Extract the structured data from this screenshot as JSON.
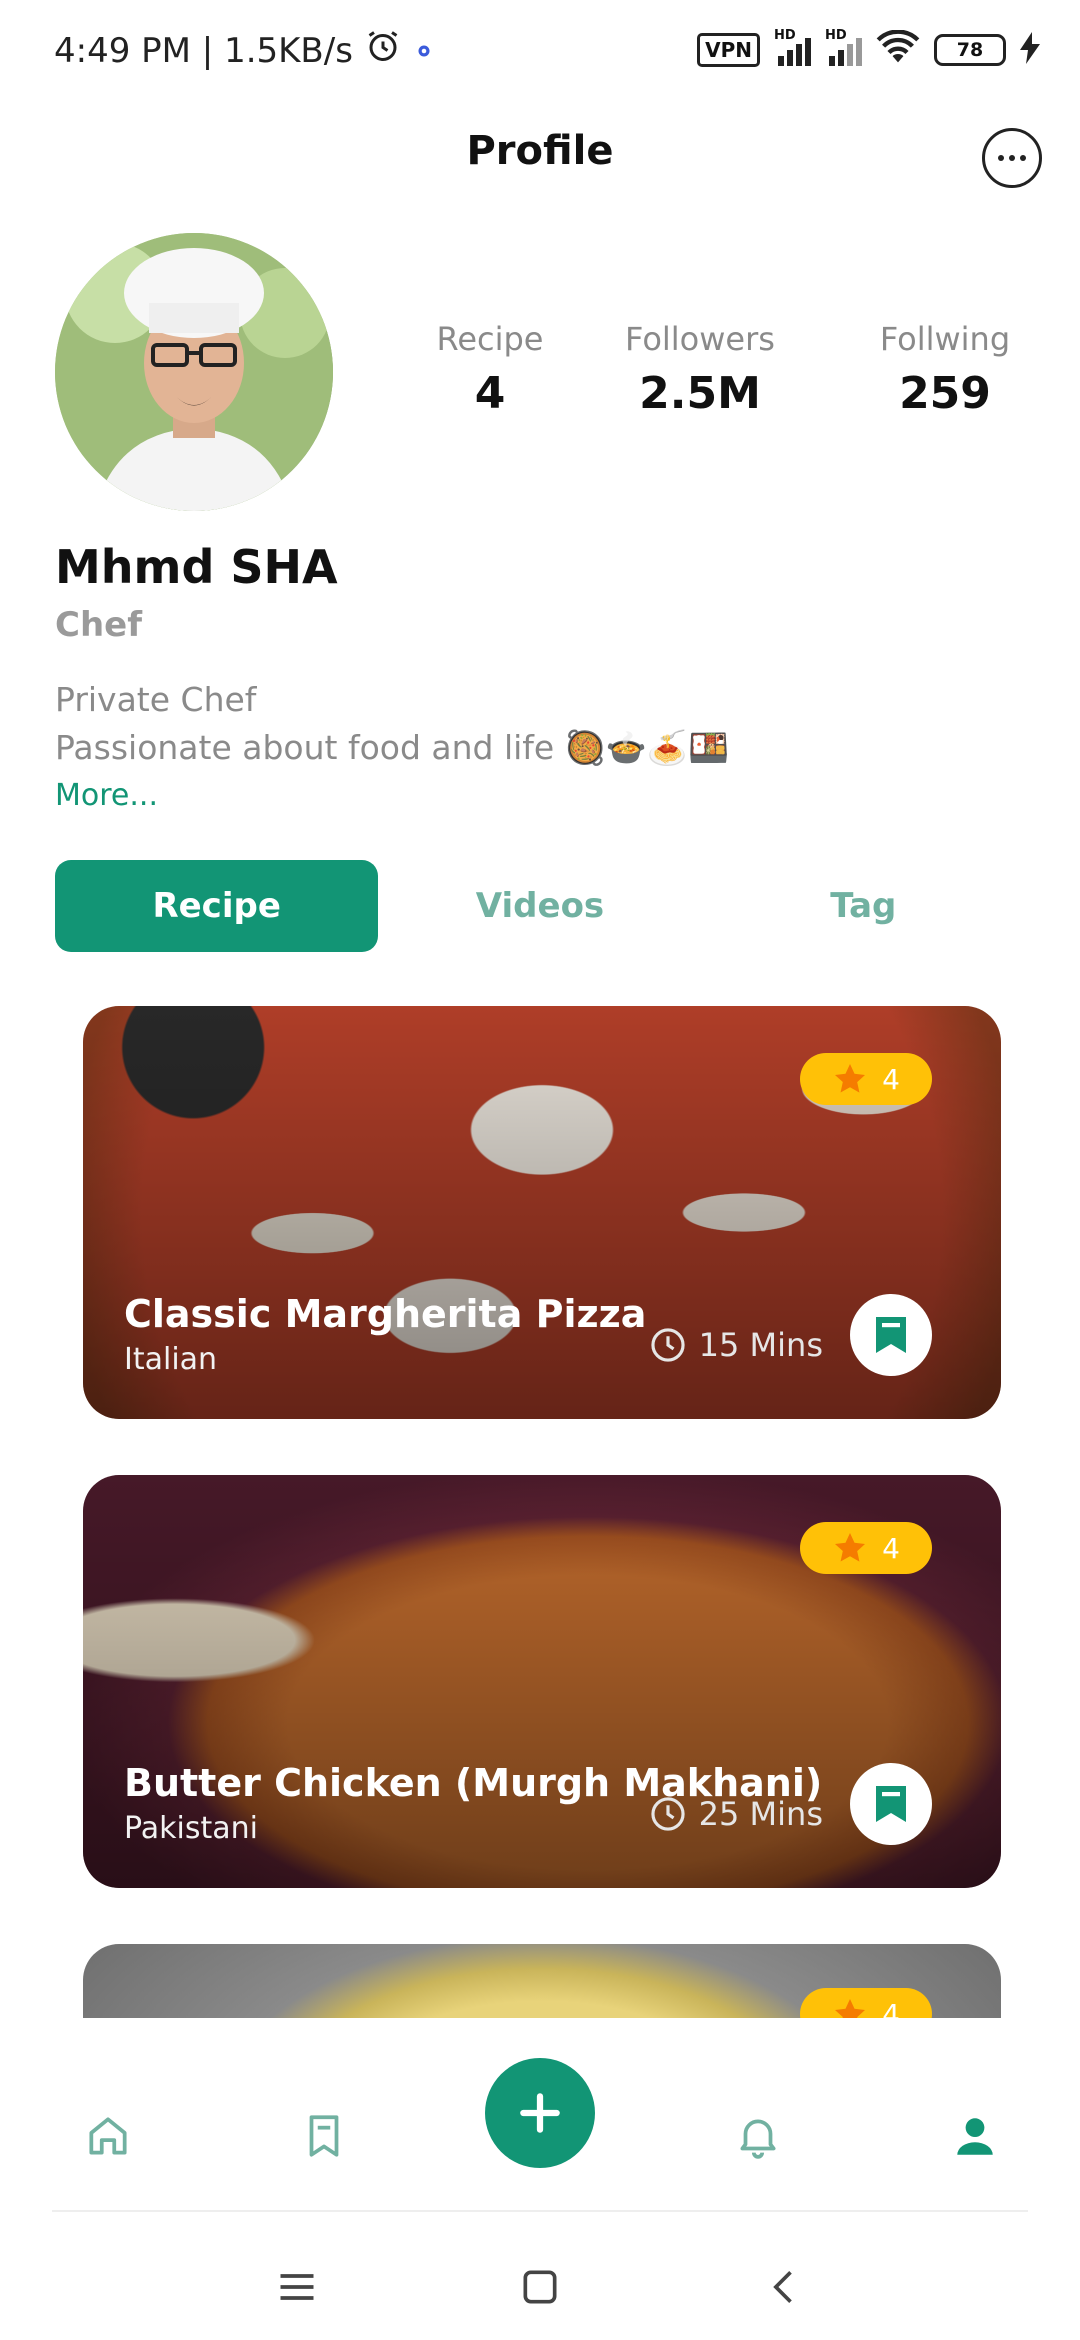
{
  "status_bar": {
    "time_speed": "4:49 PM | 1.5KB/s",
    "vpn": "VPN",
    "battery": "78",
    "signal_label": "HD"
  },
  "header": {
    "title": "Profile"
  },
  "profile": {
    "name": "Mhmd SHA",
    "role": "Chef",
    "bio_line1": "Private Chef",
    "bio_line2": "Passionate about food and life 🥘🍲🍝🍱",
    "more_link": "More...",
    "stats": [
      {
        "label": "Recipe",
        "value": "4"
      },
      {
        "label": "Followers",
        "value": "2.5M"
      },
      {
        "label": "Follwing",
        "value": "259"
      }
    ]
  },
  "tabs": [
    {
      "label": "Recipe",
      "active": true
    },
    {
      "label": "Videos",
      "active": false
    },
    {
      "label": "Tag",
      "active": false
    }
  ],
  "recipes": [
    {
      "title": "Classic Margherita Pizza",
      "cuisine": "Italian",
      "time": "15 Mins",
      "rating": "4"
    },
    {
      "title": "Butter Chicken (Murgh Makhani)",
      "cuisine": "Pakistani",
      "time": "25 Mins",
      "rating": "4"
    },
    {
      "title": "",
      "cuisine": "",
      "time": "",
      "rating": "4"
    }
  ],
  "colors": {
    "primary": "#129575",
    "rating": "#ffc107",
    "muted_text": "#8a8a8a"
  },
  "nav": {
    "items": [
      "home-icon",
      "bookmark-icon",
      "add-icon",
      "bell-icon",
      "profile-icon"
    ]
  }
}
